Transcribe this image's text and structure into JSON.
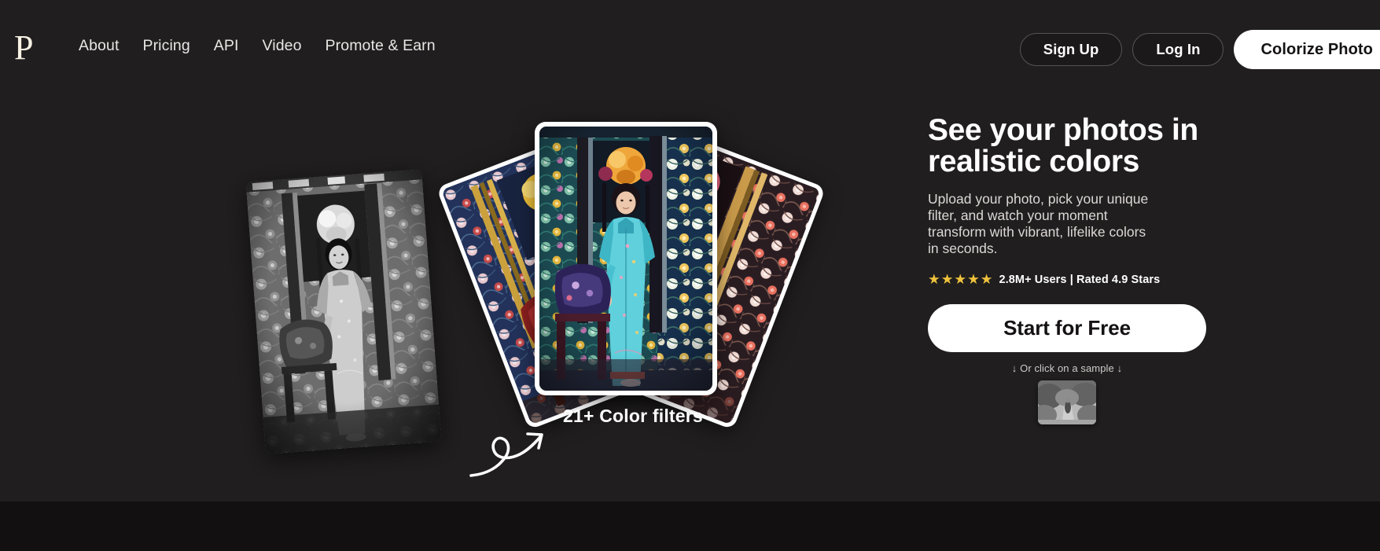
{
  "theme": {
    "background": "#201e1f",
    "bottom_band": "#121011",
    "accent_white": "#ffffff",
    "star_color": "#f0c33c",
    "logo_color": "#f7f2e4",
    "nav_text": "#e9e6e4",
    "border_muted": "#585354"
  },
  "navbar": {
    "logo_text": "P",
    "logo_icon": "letter-p-logo",
    "links": [
      {
        "label": "About"
      },
      {
        "label": "Pricing"
      },
      {
        "label": "API"
      },
      {
        "label": "Video"
      },
      {
        "label": "Promote & Earn"
      }
    ],
    "actions": {
      "sign_up": "Sign Up",
      "log_in": "Log In",
      "colorize": "Colorize Photo"
    }
  },
  "hero": {
    "headline": "See your photos in\nrealistic colors",
    "subcopy": "Upload your photo, pick your unique\nfilter, and watch your moment\ntransform with vibrant, lifelike colors\nin seconds.",
    "stars": "★★★★★",
    "star_count": 5,
    "rating_text": "2.8M+ Users | Rated 4.9 Stars",
    "cta_label": "Start for Free",
    "sample_hint": "↓ Or click on a sample ↓",
    "filters_label": "21+ Color filters",
    "arrow_icon": "curly-arrow-icon",
    "bw_photo_alt": "vintage black and white portrait of woman in traditional chinese dress",
    "cards": [
      {
        "name": "gold-filter-card",
        "tint": "gold"
      },
      {
        "name": "teal-filter-card",
        "tint": "teal"
      },
      {
        "name": "rose-filter-card",
        "tint": "rose"
      }
    ],
    "sample_thumb_alt": "grayscale sample photo of person on tree lined path"
  }
}
